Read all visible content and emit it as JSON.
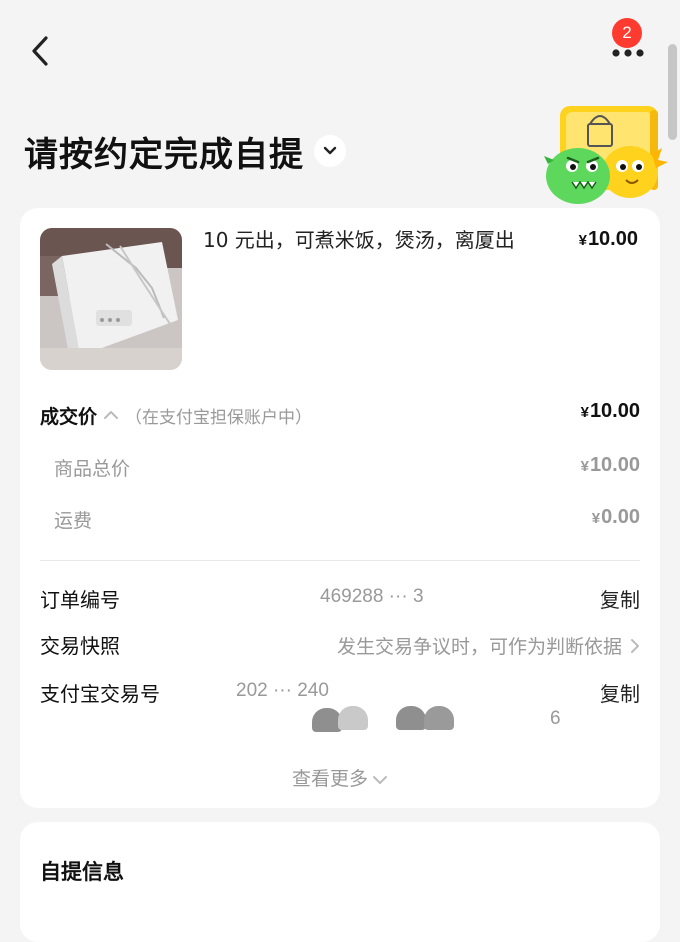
{
  "header": {
    "notification_count": "2",
    "title": "请按约定完成自提"
  },
  "product": {
    "title": "10 元出，可煮米饭，煲汤，离厦出",
    "price": "10.00",
    "currency": "¥"
  },
  "price_detail": {
    "deal_label": "成交价",
    "deal_note": "（在支付宝担保账户中）",
    "deal_price": "10.00",
    "items": [
      {
        "label": "商品总价",
        "value": "10.00"
      },
      {
        "label": "运费",
        "value": "0.00"
      }
    ]
  },
  "order_info": {
    "order_no_label": "订单编号",
    "order_no_value": "469288 ··· 3",
    "snapshot_label": "交易快照",
    "snapshot_value": "发生交易争议时，可作为判断依据",
    "alipay_label": "支付宝交易号",
    "alipay_value_line1": "202 ··· 240",
    "alipay_value_line2": "6",
    "copy_label": "复制"
  },
  "see_more": "查看更多",
  "pickup": {
    "title": "自提信息"
  },
  "colors": {
    "accent_red": "#ff3b30",
    "mascot_yellow": "#ffd21e",
    "mascot_green": "#5ed85c"
  }
}
